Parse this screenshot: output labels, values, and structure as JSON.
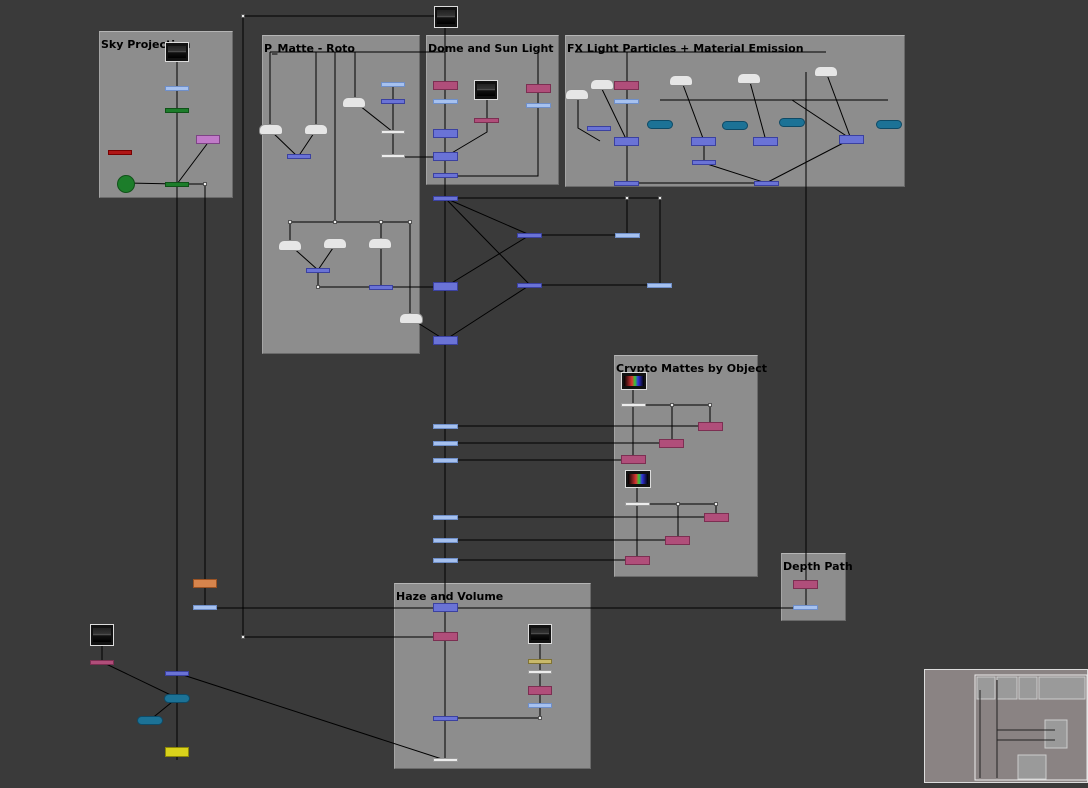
{
  "backdrops": [
    {
      "id": "sky",
      "title": "Sky Projection"
    },
    {
      "id": "roto",
      "title": "P_Matte - Roto"
    },
    {
      "id": "dome",
      "title": "Dome and Sun Light"
    },
    {
      "id": "fx",
      "title": "FX Light Particles + Material Emission"
    },
    {
      "id": "crypto",
      "title": "Crypto Mattes by Object"
    },
    {
      "id": "depth",
      "title": "Depth Path"
    },
    {
      "id": "haze",
      "title": "Haze and Volume"
    }
  ],
  "colors": {
    "canvas": "#3a3a3a",
    "backdrop": "#8d8d8d",
    "merge_node": "#6a73d6",
    "grade_node": "#b04e7a",
    "transform_node": "#a6c1ef",
    "teal_node": "#1c7296",
    "green_node": "#1c7d2a",
    "red_node": "#b01616",
    "orange_node": "#d6844c",
    "yellow_node": "#d9d21b"
  }
}
